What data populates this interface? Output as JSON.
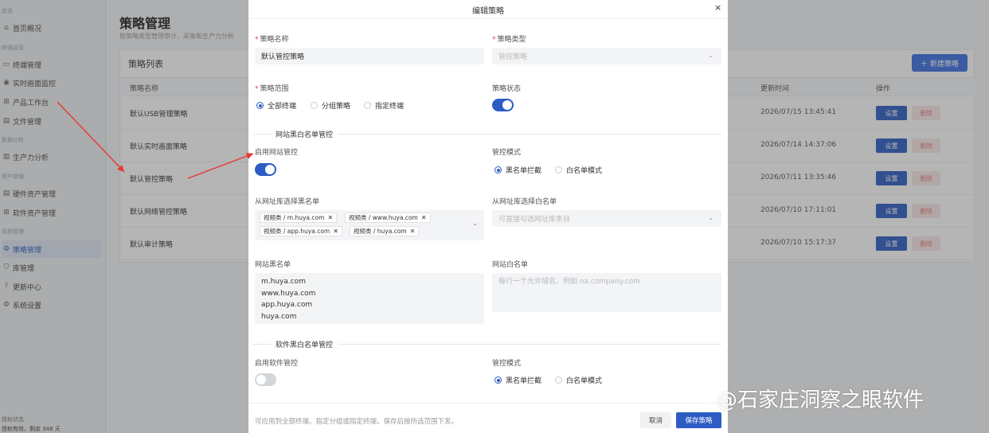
{
  "sidebar": {
    "groups": [
      "总览",
      "终端运营",
      "数据分析",
      "资产管理",
      "系统管理"
    ],
    "items": [
      {
        "label": "首页概况",
        "icon": "home-icon"
      },
      {
        "label": "终端管理",
        "icon": "monitor-icon"
      },
      {
        "label": "实时画面监控",
        "icon": "eye-icon"
      },
      {
        "label": "产品工作台",
        "icon": "grid-icon"
      },
      {
        "label": "文件管理",
        "icon": "file-icon"
      },
      {
        "label": "生产力分析",
        "icon": "bar-chart-icon"
      },
      {
        "label": "硬件资产管理",
        "icon": "list-icon"
      },
      {
        "label": "软件资产管理",
        "icon": "grid-icon"
      },
      {
        "label": "策略管理",
        "icon": "gear-icon"
      },
      {
        "label": "库管理",
        "icon": "shield-icon"
      },
      {
        "label": "更新中心",
        "icon": "upload-icon"
      },
      {
        "label": "系统设置",
        "icon": "gear-icon"
      }
    ],
    "footer_title": "授权状态",
    "footer_text": "授权有效，剩余 348 天"
  },
  "page": {
    "title": "策略管理",
    "subtitle": "按策略类型管理审计、采集和生产力分析"
  },
  "list": {
    "title": "策略列表",
    "new_button": "＋ 新建策略",
    "columns": [
      "策略名称",
      "更新时间",
      "操作"
    ],
    "rows": [
      {
        "name": "默认USB管理策略",
        "time": "2026/07/15 13:45:41"
      },
      {
        "name": "默认实时画面策略",
        "time": "2026/07/14 14:37:06"
      },
      {
        "name": "默认管控策略",
        "time": "2026/07/11 13:35:46"
      },
      {
        "name": "默认网络管控策略",
        "time": "2026/07/10 17:11:01"
      },
      {
        "name": "默认审计策略",
        "time": "2026/07/10 15:17:37"
      }
    ],
    "set_label": "设置",
    "delete_label": "删除"
  },
  "modal": {
    "title": "编辑策略",
    "close": "×",
    "name_label": "策略名称",
    "name_value": "默认管控策略",
    "type_label": "策略类型",
    "type_value": "管控策略",
    "scope_label": "策略范围",
    "scope_options": [
      "全部终端",
      "分组策略",
      "指定终端"
    ],
    "status_label": "策略状态",
    "web_section": "网站黑白名单管控",
    "enable_web_label": "启用网站管控",
    "mode_label": "管控模式",
    "mode_options": [
      "黑名单拦截",
      "白名单模式"
    ],
    "black_lib_label": "从网址库选择黑名单",
    "black_tags": [
      "视频类 / m.huya.com",
      "视频类 / www.huya.com",
      "视频类 / app.huya.com",
      "视频类 / huya.com"
    ],
    "white_lib_label": "从网址库选择白名单",
    "white_lib_placeholder": "可直接勾选网址库条目",
    "blacklist_label": "网站黑名单",
    "blacklist_lines": [
      "m.huya.com",
      "www.huya.com",
      "app.huya.com",
      "huya.com"
    ],
    "whitelist_label": "网站白名单",
    "whitelist_placeholder": "每行一个允许域名，例如 oa.company.com",
    "soft_section": "软件黑白名单管控",
    "enable_soft_label": "启用软件管控",
    "soft_mode_label": "管控模式",
    "footer_note": "可应用到全部终端、指定分组或指定终端，保存后按所选范围下发。",
    "cancel": "取消",
    "save": "保存策略"
  },
  "watermark": {
    "text": "@石家庄洞察之眼软件",
    "badge": "du"
  },
  "colors": {
    "primary": "#2d5cc4",
    "required": "#e04545",
    "arrow": "#e8382e"
  }
}
